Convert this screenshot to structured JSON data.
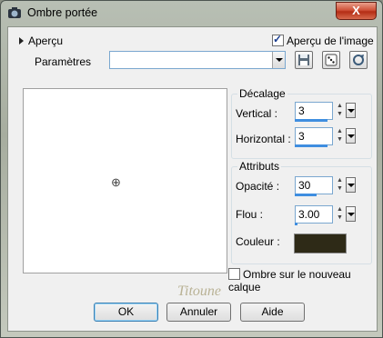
{
  "window": {
    "title": "Ombre portée",
    "close_glyph": "X"
  },
  "preview_section": {
    "toggle_label": "Aperçu",
    "preview_image_checkbox": {
      "label": "Aperçu de l'image",
      "checked": true
    }
  },
  "params": {
    "label": "Paramètres",
    "value": ""
  },
  "decalage": {
    "title": "Décalage",
    "vertical": {
      "label": "Vertical :",
      "value": "3"
    },
    "horizontal": {
      "label": "Horizontal :",
      "value": "3"
    }
  },
  "attributs": {
    "title": "Attributs",
    "opacite": {
      "label": "Opacité :",
      "value": "30"
    },
    "flou": {
      "label": "Flou :",
      "value": "3.00"
    },
    "couleur": {
      "label": "Couleur :",
      "value_hex": "#2e2a17"
    }
  },
  "shadow_new_layer": {
    "label": "Ombre sur le nouveau calque",
    "checked": false
  },
  "signature": "Titoune",
  "buttons": {
    "ok": "OK",
    "cancel": "Annuler",
    "help": "Aide"
  }
}
